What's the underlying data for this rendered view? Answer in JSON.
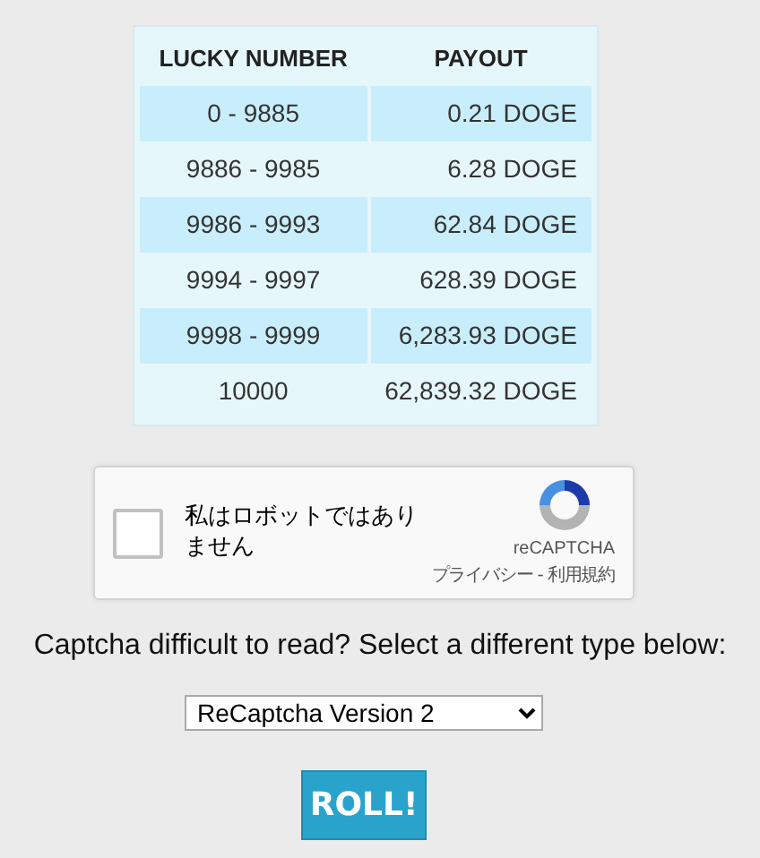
{
  "payout_table": {
    "columns": [
      "LUCKY NUMBER",
      "PAYOUT"
    ],
    "rows": [
      [
        "0 - 9885",
        "0.21 DOGE"
      ],
      [
        "9886 - 9985",
        "6.28 DOGE"
      ],
      [
        "9986 - 9993",
        "62.84 DOGE"
      ],
      [
        "9994 - 9997",
        "628.39 DOGE"
      ],
      [
        "9998 - 9999",
        "6,283.93 DOGE"
      ],
      [
        "10000",
        "62,839.32 DOGE"
      ]
    ]
  },
  "captcha": {
    "checked": false,
    "label": "私はロボットではありません",
    "brand": "reCAPTCHA",
    "links": [
      "プライバシー",
      "利用規約"
    ],
    "separator": "-"
  },
  "captcha_prompt": "Captcha difficult to read? Select a different type below:",
  "captcha_type": {
    "value": "ReCaptcha Version 2"
  },
  "roll_button": "ROLL!"
}
